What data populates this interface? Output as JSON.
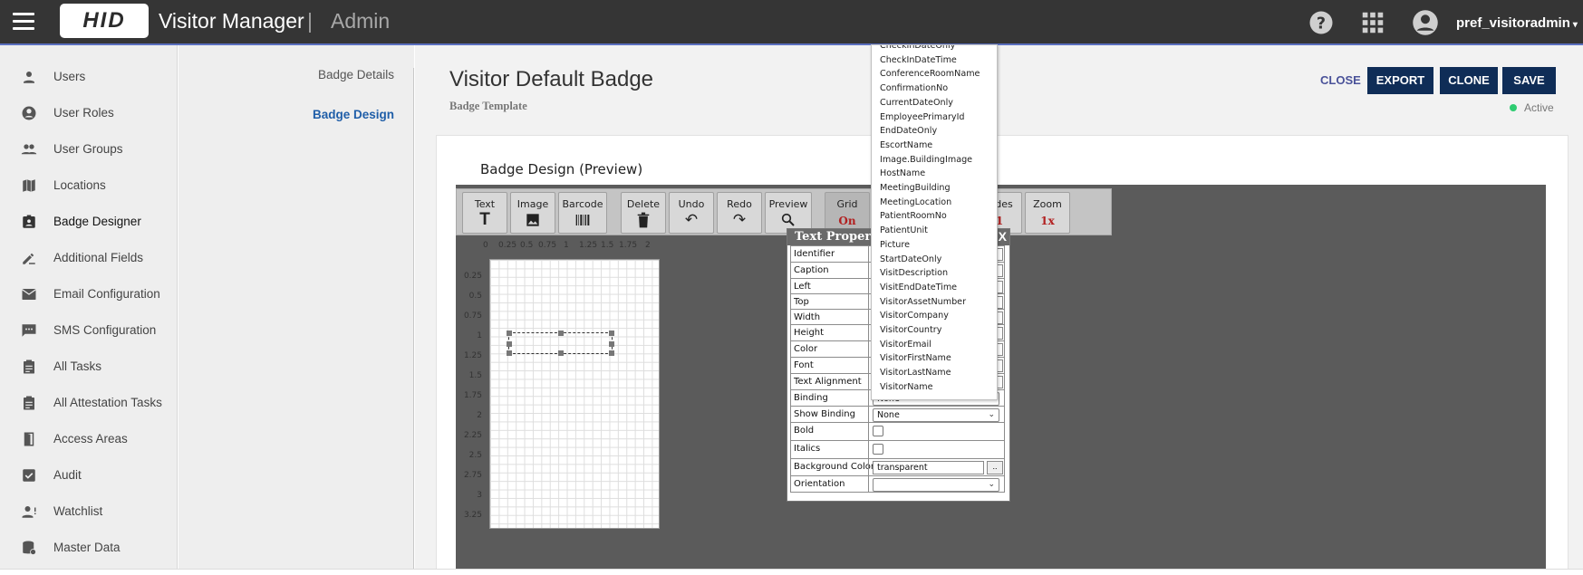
{
  "header": {
    "logo_text": "HID",
    "product_name": "Visitor Manager",
    "separator": "|",
    "section": "Admin",
    "username": "pref_visitoradmin",
    "icons": [
      "help-icon",
      "apps-grid-icon",
      "account-circle-icon",
      "caret-down-icon"
    ]
  },
  "sidebar": {
    "items": [
      {
        "label": "Users",
        "icon": "person-icon"
      },
      {
        "label": "User Roles",
        "icon": "account-circle-icon"
      },
      {
        "label": "User Groups",
        "icon": "people-icon"
      },
      {
        "label": "Locations",
        "icon": "map-icon"
      },
      {
        "label": "Badge Designer",
        "icon": "badge-icon",
        "active": true
      },
      {
        "label": "Additional Fields",
        "icon": "edit-fields-icon"
      },
      {
        "label": "Email Configuration",
        "icon": "mail-icon"
      },
      {
        "label": "SMS Configuration",
        "icon": "sms-icon"
      },
      {
        "label": "All Tasks",
        "icon": "clipboard-icon"
      },
      {
        "label": "All Attestation Tasks",
        "icon": "clipboard-icon"
      },
      {
        "label": "Access Areas",
        "icon": "door-icon"
      },
      {
        "label": "Audit",
        "icon": "checkbox-icon"
      },
      {
        "label": "Watchlist",
        "icon": "person-alert-icon"
      },
      {
        "label": "Master Data",
        "icon": "database-icon"
      }
    ]
  },
  "subnav": {
    "badge_details": "Badge Details",
    "badge_design": "Badge Design"
  },
  "page": {
    "title": "Visitor Default Badge",
    "subtitle": "Badge Template",
    "close": "CLOSE",
    "export": "EXPORT",
    "clone": "CLONE",
    "save": "SAVE",
    "status": "Active",
    "status_color": "#2ecc71",
    "accent": "#0f2d57"
  },
  "designer": {
    "heading": "Badge Design (Preview)",
    "toolbar": {
      "text": "Text",
      "image": "Image",
      "barcode": "Barcode",
      "delete": "Delete",
      "undo": "Undo",
      "redo": "Redo",
      "preview": "Preview",
      "grid": "Grid",
      "grid_value": "On",
      "sides": "Sides",
      "sides_value": "1",
      "zoom": "Zoom",
      "zoom_value": "1x",
      "partial_label": "t"
    },
    "ruler_h": [
      "0",
      "0.25",
      "0.5",
      "0.75",
      "1",
      "1.25",
      "1.5",
      "1.75",
      "2"
    ],
    "ruler_v": [
      "0.25",
      "0.5",
      "0.75",
      "1",
      "1.25",
      "1.5",
      "1.75",
      "2",
      "2.25",
      "2.5",
      "2.75",
      "3",
      "3.25"
    ]
  },
  "text_properties": {
    "title": "Text Proper",
    "close": "X",
    "rows": {
      "identifier": "Identifier",
      "caption": "Caption",
      "left": "Left",
      "top": "Top",
      "width": "Width",
      "height": "Height",
      "color": "Color",
      "font": "Font",
      "text_alignment": "Text Alignment",
      "binding": "Binding",
      "show_binding": "Show Binding",
      "bold": "Bold",
      "italics": "Italics",
      "background_color": "Background Color",
      "orientation": "Orientation"
    },
    "binding_value": "None",
    "show_binding_value": "None",
    "background_color_value": "transparent",
    "dots": ".."
  },
  "binding_options": [
    "CheckInDateOnly",
    "CheckInDateTime",
    "ConferenceRoomName",
    "ConfirmationNo",
    "CurrentDateOnly",
    "EmployeePrimaryId",
    "EndDateOnly",
    "EscortName",
    "Image.BuildingImage",
    "HostName",
    "MeetingBuilding",
    "MeetingLocation",
    "PatientRoomNo",
    "PatientUnit",
    "Picture",
    "StartDateOnly",
    "VisitDescription",
    "VisitEndDateTime",
    "VisitorAssetNumber",
    "VisitorCompany",
    "VisitorCountry",
    "VisitorEmail",
    "VisitorFirstName",
    "VisitorLastName",
    "VisitorName"
  ]
}
